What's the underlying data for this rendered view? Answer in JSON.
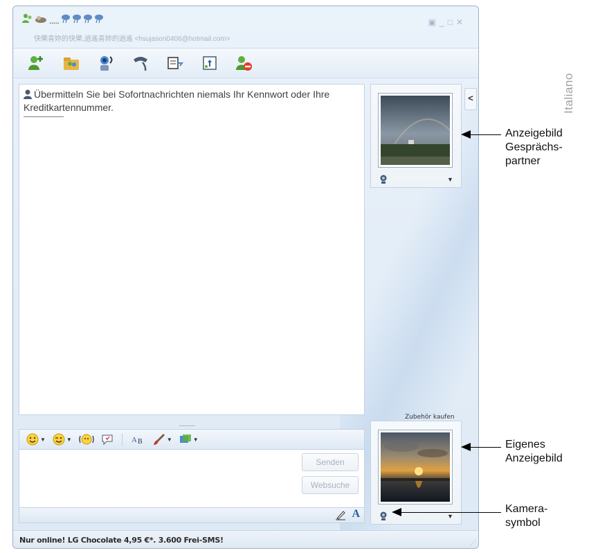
{
  "window": {
    "contact_name": ".....",
    "contact_subtitle": "快樂喜妳的快樂,逍遙喜妳的逍遙 <hsujason0406@hotmail.com>",
    "controls": [
      "▣",
      "_",
      "□",
      "✕"
    ]
  },
  "toolbar": {
    "items": [
      "invite-contact",
      "share-folder",
      "video-call",
      "voice-call",
      "activities",
      "games",
      "block-contact"
    ]
  },
  "conversation": {
    "warning": "Übermitteln Sie bei Sofortnachrichten niemals Ihr Kennwort oder Ihre Kreditkartennummer."
  },
  "splitter": ".........",
  "input": {
    "send_label": "Senden",
    "search_label": "Websuche",
    "font_label": "A"
  },
  "status": {
    "ad_text": "Nur online! LG Chocolate 4,95 €*. 3.600 Frei-SMS!"
  },
  "sidebar": {
    "collapse_label": "<",
    "accessories_label": "Zubehör kaufen",
    "dropdown_arrow": "▼"
  },
  "annotations": {
    "side_label": "Italiano",
    "partner_picture": "Anzeigebild Gesprächs-partner",
    "partner_picture_lines": [
      "Anzeigebild",
      "Gesprächs-",
      "partner"
    ],
    "own_picture_lines": [
      "Eigenes",
      "Anzeigebild"
    ],
    "camera_lines": [
      "Kamera-",
      "symbol"
    ]
  }
}
